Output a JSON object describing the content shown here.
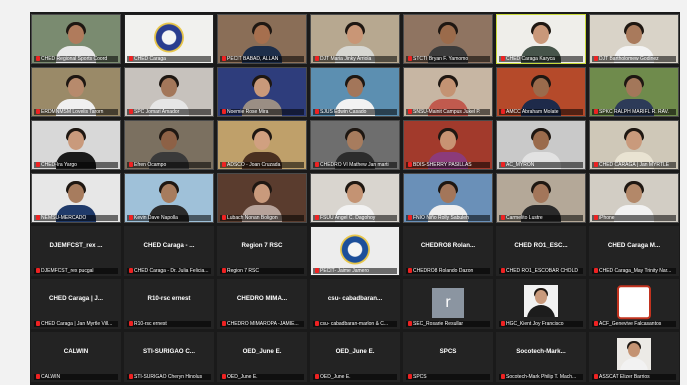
{
  "grid": {
    "tiles": [
      {
        "label": "CHED Regional Sports Coord",
        "kind": "video",
        "bg": "#7a8b70",
        "skin": "#b07b5c",
        "shirt": "#e9e9e9"
      },
      {
        "label": "CHED Caraga",
        "kind": "emblem",
        "bg": "#f1f1ee",
        "emblem": "#2a3d8f"
      },
      {
        "label": "PECIT BABAD, ALLAN",
        "kind": "video",
        "bg": "#8a6e57",
        "skin": "#a66f4e",
        "shirt": "#1d2e4a"
      },
      {
        "label": "DJT Maria Jinky Arriola",
        "kind": "video",
        "bg": "#b7a890",
        "skin": "#c99676",
        "shirt": "#d7d7d2"
      },
      {
        "label": "STCTI Bryan F. Yamomo",
        "kind": "video",
        "bg": "#8f7461",
        "skin": "#9b6b4b",
        "shirt": "#3b3b3b"
      },
      {
        "label": "CHED Caraga Karyca",
        "kind": "video",
        "bg": "#efeeea",
        "skin": "#c9987a",
        "shirt": "#46544a",
        "active": true
      },
      {
        "label": "DJT Bartholomew Godinez",
        "kind": "video",
        "bg": "#d9d3c8",
        "skin": "#a97a5c",
        "shirt": "#f3f3f3"
      },
      {
        "label": "ERDMNMSM Lovelis Tarorn",
        "kind": "video",
        "bg": "#9a8a68",
        "skin": "#b78a6c",
        "shirt": "#f0f0f0"
      },
      {
        "label": "SPC Jomari Amador",
        "kind": "video",
        "bg": "#c7c2bd",
        "skin": "#a3775a",
        "shirt": "#e6e6e6"
      },
      {
        "label": "Noemie Rose Mira",
        "kind": "video",
        "bg": "#2e3d7c",
        "skin": "#c9997a",
        "shirt": "#9a8e84"
      },
      {
        "label": "SJUS Edwin Casado",
        "kind": "video",
        "bg": "#5c8fb1",
        "skin": "#a3765a",
        "shirt": "#f2f2f2"
      },
      {
        "label": "SNSU-Mainit Campus Jukel P.",
        "kind": "video",
        "bg": "#c7b6a3",
        "skin": "#c49373",
        "shirt": "#c15a4e"
      },
      {
        "label": "AMCC Abraham Molate",
        "kind": "video",
        "bg": "#b54a2a",
        "skin": "#9a6b4c",
        "shirt": "#1e2a4a"
      },
      {
        "label": "SPKC RALPH MARIFL R. RAV.",
        "kind": "video",
        "bg": "#6f8b4c",
        "skin": "#a3775a",
        "shirt": "#2d3b58"
      },
      {
        "label": "CHED-Ira Yargo",
        "kind": "video",
        "bg": "#d8d8d8",
        "skin": "#c99a7c",
        "shirt": "#1a1a1a"
      },
      {
        "label": "Efren Ocampo",
        "kind": "video",
        "bg": "#7b7060",
        "skin": "#8d6146",
        "shirt": "#3a3a3a"
      },
      {
        "label": "ADSCO - Joan Cruzada",
        "kind": "video",
        "bg": "#bfa06a",
        "skin": "#d0a080",
        "shirt": "#4a3020"
      },
      {
        "label": "CHEDRO VI Mathew Jan marti",
        "kind": "video",
        "bg": "#6e6e6e",
        "skin": "#a77c5e",
        "shirt": "#2c2c2c"
      },
      {
        "label": "BDIS-SHERRY PASILLAS",
        "kind": "video",
        "bg": "#a23a2c",
        "skin": "#c89373",
        "shirt": "#8c3b7a"
      },
      {
        "label": "AC_MYRON",
        "kind": "video",
        "bg": "#c9c9c9",
        "skin": "#9a6b4c",
        "shirt": "#e2e2e2"
      },
      {
        "label": "CHED CARAGA | Jan MYRTLE",
        "kind": "video",
        "bg": "#cfc8b8",
        "skin": "#c99a7c",
        "shirt": "#e9e3d2"
      },
      {
        "label": "NEMSU-MERCADO",
        "kind": "video",
        "bg": "#e7e7e7",
        "skin": "#a77c5e",
        "shirt": "#1f3a6a"
      },
      {
        "label": "Kevin Dave Napolla",
        "kind": "video",
        "bg": "#9fc1d9",
        "skin": "#a77c5e",
        "shirt": "#2c2c2c"
      },
      {
        "label": "Lubach Nonan Boligon",
        "kind": "video",
        "bg": "#5a3c2e",
        "skin": "#c99a7c",
        "shirt": "#b7a39a"
      },
      {
        "label": "FSUU Angel C. Dagohoy",
        "kind": "video",
        "bg": "#d9d5cf",
        "skin": "#c49373",
        "shirt": "#f2f2f2"
      },
      {
        "label": "FNIO Niño Rolly Sabuleh",
        "kind": "video",
        "bg": "#6a90b8",
        "skin": "#a3765a",
        "shirt": "#efefef"
      },
      {
        "label": "Carmelito Lustre",
        "kind": "video",
        "bg": "#b4a898",
        "skin": "#a3765a",
        "shirt": "#2a2a2a"
      },
      {
        "label": "iPhone",
        "kind": "video",
        "bg": "#d2cdc4",
        "skin": "#b38869",
        "shirt": "#f2f2f2"
      },
      {
        "label": "DJEMFCST_rex pucgal",
        "kind": "name",
        "title": "DJEMFCST_rex ..."
      },
      {
        "label": "CHED Caraga - Dr. Julia Felicia...",
        "kind": "name",
        "title": "CHED Caraga - ..."
      },
      {
        "label": "Region 7 RSC",
        "kind": "name",
        "title": "Region 7 RSC"
      },
      {
        "label": "PECIT- Jaime Jamero",
        "kind": "emblem",
        "bg": "#ededed",
        "emblem": "#1d4f9a"
      },
      {
        "label": "CHEDRO8 Rolando Dazon",
        "kind": "name",
        "title": "CHEDRO8 Rolan..."
      },
      {
        "label": "CHED RO1_ESCOBAR CHOLD",
        "kind": "name",
        "title": "CHED RO1_ESC..."
      },
      {
        "label": "CHED Caraga_May Trinity Nar...",
        "kind": "name",
        "title": "CHED Caraga M..."
      },
      {
        "label": "CHED Caraga | Jan Myrtle Vill...",
        "kind": "name",
        "title": "CHED Caraga | J..."
      },
      {
        "label": "R10-rsc ernest",
        "kind": "name",
        "title": "R10-rsc ernest"
      },
      {
        "label": "CHEDRO MIMAROPA -JAMIE...",
        "kind": "name",
        "title": "CHEDRO MIMA..."
      },
      {
        "label": "csu- cabadbaran-marlon & C...",
        "kind": "name",
        "title": "csu- cabadbaran..."
      },
      {
        "label": "SEC_Rosarie Resullar",
        "kind": "letter",
        "letter": "r"
      },
      {
        "label": "HGC_Kient Joy Francisco",
        "kind": "photo",
        "bg": "#f2f2f2",
        "skin": "#c99a7c",
        "shirt": "#1c1c1c"
      },
      {
        "label": "ACF_Genevive Falcasantos",
        "kind": "logo",
        "bg": "#ffffff",
        "emblem": "#c2331f"
      },
      {
        "label": "CALWIN",
        "kind": "name",
        "title": "CALWIN"
      },
      {
        "label": "STI-SURIGAO Cheryn Hinolus",
        "kind": "name",
        "title": "STI-SURIGAO C..."
      },
      {
        "label": "OED_June E.",
        "kind": "name",
        "title": "OED_June E."
      },
      {
        "label": "OED_June E.",
        "kind": "name",
        "title": "OED_June E."
      },
      {
        "label": "SPCS",
        "kind": "name",
        "title": "SPCS"
      },
      {
        "label": "Socotech-Mark Philip T. Mach...",
        "kind": "name",
        "title": "Socotech-Mark..."
      },
      {
        "label": "ASSCAT Elizer Barrios",
        "kind": "photo",
        "bg": "#eceae6",
        "skin": "#c49373",
        "shirt": "#f2f2f2"
      }
    ]
  }
}
